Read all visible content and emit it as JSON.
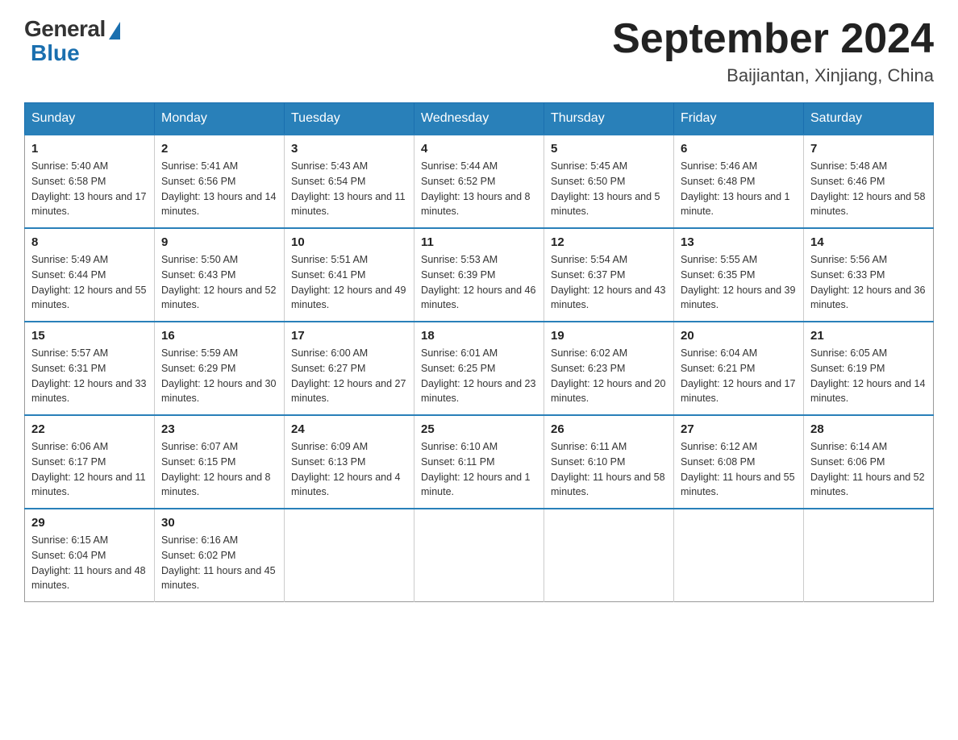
{
  "header": {
    "logo_general": "General",
    "logo_blue": "Blue",
    "month_year": "September 2024",
    "location": "Baijiantan, Xinjiang, China"
  },
  "weekdays": [
    "Sunday",
    "Monday",
    "Tuesday",
    "Wednesday",
    "Thursday",
    "Friday",
    "Saturday"
  ],
  "weeks": [
    [
      {
        "day": "1",
        "sunrise": "5:40 AM",
        "sunset": "6:58 PM",
        "daylight": "13 hours and 17 minutes."
      },
      {
        "day": "2",
        "sunrise": "5:41 AM",
        "sunset": "6:56 PM",
        "daylight": "13 hours and 14 minutes."
      },
      {
        "day": "3",
        "sunrise": "5:43 AM",
        "sunset": "6:54 PM",
        "daylight": "13 hours and 11 minutes."
      },
      {
        "day": "4",
        "sunrise": "5:44 AM",
        "sunset": "6:52 PM",
        "daylight": "13 hours and 8 minutes."
      },
      {
        "day": "5",
        "sunrise": "5:45 AM",
        "sunset": "6:50 PM",
        "daylight": "13 hours and 5 minutes."
      },
      {
        "day": "6",
        "sunrise": "5:46 AM",
        "sunset": "6:48 PM",
        "daylight": "13 hours and 1 minute."
      },
      {
        "day": "7",
        "sunrise": "5:48 AM",
        "sunset": "6:46 PM",
        "daylight": "12 hours and 58 minutes."
      }
    ],
    [
      {
        "day": "8",
        "sunrise": "5:49 AM",
        "sunset": "6:44 PM",
        "daylight": "12 hours and 55 minutes."
      },
      {
        "day": "9",
        "sunrise": "5:50 AM",
        "sunset": "6:43 PM",
        "daylight": "12 hours and 52 minutes."
      },
      {
        "day": "10",
        "sunrise": "5:51 AM",
        "sunset": "6:41 PM",
        "daylight": "12 hours and 49 minutes."
      },
      {
        "day": "11",
        "sunrise": "5:53 AM",
        "sunset": "6:39 PM",
        "daylight": "12 hours and 46 minutes."
      },
      {
        "day": "12",
        "sunrise": "5:54 AM",
        "sunset": "6:37 PM",
        "daylight": "12 hours and 43 minutes."
      },
      {
        "day": "13",
        "sunrise": "5:55 AM",
        "sunset": "6:35 PM",
        "daylight": "12 hours and 39 minutes."
      },
      {
        "day": "14",
        "sunrise": "5:56 AM",
        "sunset": "6:33 PM",
        "daylight": "12 hours and 36 minutes."
      }
    ],
    [
      {
        "day": "15",
        "sunrise": "5:57 AM",
        "sunset": "6:31 PM",
        "daylight": "12 hours and 33 minutes."
      },
      {
        "day": "16",
        "sunrise": "5:59 AM",
        "sunset": "6:29 PM",
        "daylight": "12 hours and 30 minutes."
      },
      {
        "day": "17",
        "sunrise": "6:00 AM",
        "sunset": "6:27 PM",
        "daylight": "12 hours and 27 minutes."
      },
      {
        "day": "18",
        "sunrise": "6:01 AM",
        "sunset": "6:25 PM",
        "daylight": "12 hours and 23 minutes."
      },
      {
        "day": "19",
        "sunrise": "6:02 AM",
        "sunset": "6:23 PM",
        "daylight": "12 hours and 20 minutes."
      },
      {
        "day": "20",
        "sunrise": "6:04 AM",
        "sunset": "6:21 PM",
        "daylight": "12 hours and 17 minutes."
      },
      {
        "day": "21",
        "sunrise": "6:05 AM",
        "sunset": "6:19 PM",
        "daylight": "12 hours and 14 minutes."
      }
    ],
    [
      {
        "day": "22",
        "sunrise": "6:06 AM",
        "sunset": "6:17 PM",
        "daylight": "12 hours and 11 minutes."
      },
      {
        "day": "23",
        "sunrise": "6:07 AM",
        "sunset": "6:15 PM",
        "daylight": "12 hours and 8 minutes."
      },
      {
        "day": "24",
        "sunrise": "6:09 AM",
        "sunset": "6:13 PM",
        "daylight": "12 hours and 4 minutes."
      },
      {
        "day": "25",
        "sunrise": "6:10 AM",
        "sunset": "6:11 PM",
        "daylight": "12 hours and 1 minute."
      },
      {
        "day": "26",
        "sunrise": "6:11 AM",
        "sunset": "6:10 PM",
        "daylight": "11 hours and 58 minutes."
      },
      {
        "day": "27",
        "sunrise": "6:12 AM",
        "sunset": "6:08 PM",
        "daylight": "11 hours and 55 minutes."
      },
      {
        "day": "28",
        "sunrise": "6:14 AM",
        "sunset": "6:06 PM",
        "daylight": "11 hours and 52 minutes."
      }
    ],
    [
      {
        "day": "29",
        "sunrise": "6:15 AM",
        "sunset": "6:04 PM",
        "daylight": "11 hours and 48 minutes."
      },
      {
        "day": "30",
        "sunrise": "6:16 AM",
        "sunset": "6:02 PM",
        "daylight": "11 hours and 45 minutes."
      },
      null,
      null,
      null,
      null,
      null
    ]
  ],
  "labels": {
    "sunrise": "Sunrise:",
    "sunset": "Sunset:",
    "daylight": "Daylight:"
  }
}
